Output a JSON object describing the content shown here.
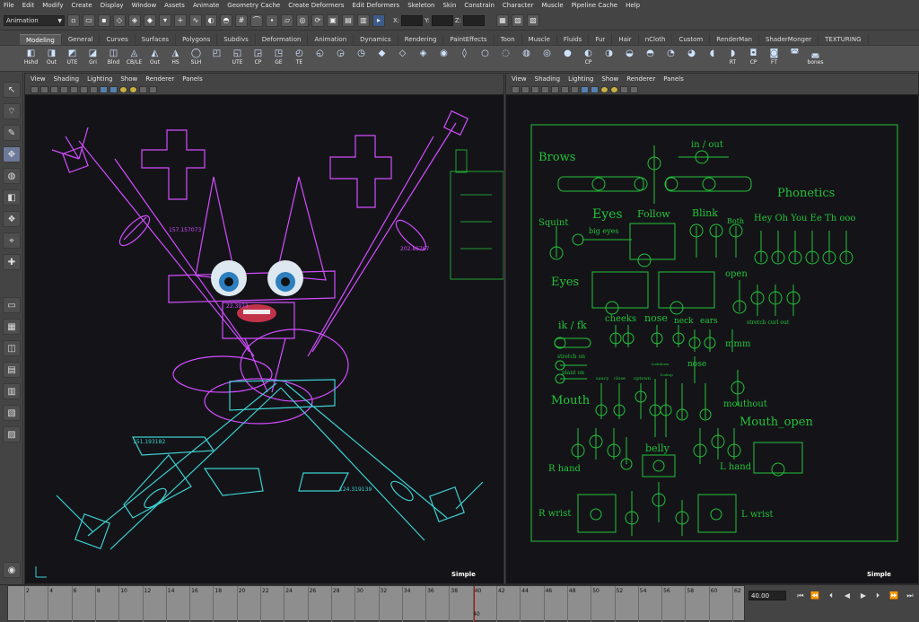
{
  "menubar": [
    "File",
    "Edit",
    "Modify",
    "Create",
    "Display",
    "Window",
    "Assets",
    "Animate",
    "Geometry Cache",
    "Create Deformers",
    "Edit Deformers",
    "Skeleton",
    "Skin",
    "Constrain",
    "Character",
    "Muscle",
    "Pipeline Cache",
    "Help"
  ],
  "statusline": {
    "mode": "Animation",
    "x_label": "X:",
    "y_label": "Y:",
    "z_label": "Z:"
  },
  "shelf_tabs": [
    "Modeling",
    "General",
    "Curves",
    "Surfaces",
    "Polygons",
    "Subdivs",
    "Deformation",
    "Animation",
    "Dynamics",
    "Rendering",
    "PaintEffects",
    "Toon",
    "Muscle",
    "Fluids",
    "Fur",
    "Hair",
    "nCloth",
    "Custom",
    "RenderMan",
    "ShaderMonger",
    "TEXTURING"
  ],
  "shelf_buttons": [
    "Hshd",
    "Out",
    "UTE",
    "Gri",
    "Blnd",
    "CB/LE",
    "Out",
    "HS",
    "SLH",
    "",
    "UTE",
    "CP",
    "GE",
    "TE",
    "",
    "",
    "",
    "",
    "",
    "",
    "",
    "",
    "",
    "",
    "",
    "",
    "",
    "CP",
    "",
    "",
    "",
    "",
    "",
    "",
    "RT",
    "CP",
    "FT",
    "",
    "bones"
  ],
  "panels": {
    "left": {
      "menu": [
        "View",
        "Shading",
        "Lighting",
        "Show",
        "Renderer",
        "Panels"
      ],
      "camera": "Simple"
    },
    "right": {
      "menu": [
        "View",
        "Shading",
        "Lighting",
        "Show",
        "Renderer",
        "Panels"
      ],
      "camera": "Simple"
    }
  },
  "left_viewport": {
    "distances": [
      "157.157073",
      "202.86767",
      "22.3973",
      "151.193182",
      "124.319139"
    ]
  },
  "face_gui": {
    "labels": {
      "brows": "Brows",
      "in_out": "in / out",
      "phonetics": "Phonetics",
      "squint": "Squint",
      "eyes_big": "Eyes",
      "follow": "Follow",
      "blink": "Blink",
      "both": "Both",
      "phonemes": "Hey Oh You Ee Th ooo",
      "big_eyes": "big eyes",
      "eyes": "Eyes",
      "open": "open",
      "ik_fk": "ik / fk",
      "cheeks": "cheeks",
      "nose": "nose",
      "neck": "neck",
      "ears": "ears",
      "stretch_curl_out": "stretch curl out",
      "mmm": "mmm",
      "stretch_on": "stretch on",
      "plant_on": "plant on",
      "nose2": "nose",
      "saucy": "saucy",
      "close": "close",
      "uptown": "uptown",
      "lookdown": "lookdown",
      "lookup": "lookup",
      "mouth": "Mouth",
      "mouthout": "mouthout",
      "mouth_open": "Mouth_open",
      "belly": "belly",
      "r_hand": "R hand",
      "l_hand": "L hand",
      "r_wrist": "R wrist",
      "l_wrist": "L wrist"
    }
  },
  "timeline": {
    "ticks": [
      "2",
      "4",
      "6",
      "8",
      "10",
      "12",
      "14",
      "16",
      "18",
      "20",
      "22",
      "24",
      "26",
      "28",
      "30",
      "32",
      "34",
      "36",
      "38",
      "40",
      "42",
      "44",
      "46",
      "48",
      "50",
      "52",
      "54",
      "56",
      "58",
      "60",
      "62"
    ],
    "current_frame_label": "40",
    "current_frame": "40.00"
  },
  "colors": {
    "accent": "#3d5c8c",
    "rig_magenta": "#d24cff",
    "rig_cyan": "#3ecfd0",
    "gui_green": "#23c23a"
  }
}
